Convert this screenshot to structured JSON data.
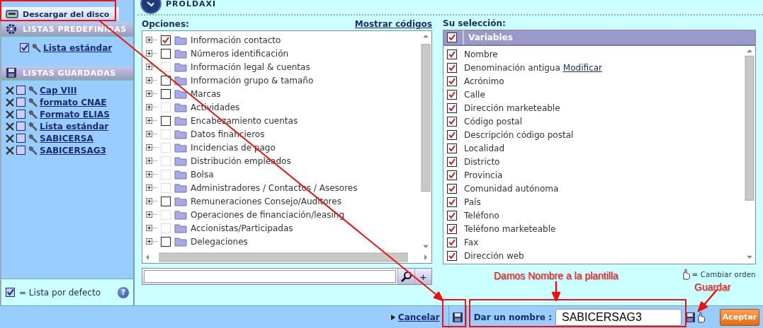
{
  "header": {
    "title": "PROLDAXI"
  },
  "sidebar": {
    "download_button": "Descargar del disco",
    "predefined": {
      "title": "LISTAS PREDEFINIDAS",
      "items": [
        {
          "label": "Lista estándar",
          "checked": true
        }
      ]
    },
    "saved": {
      "title": "LISTAS GUARDADAS",
      "items": [
        {
          "label": "Cap VIII",
          "checked": false
        },
        {
          "label": "formato CNAE",
          "checked": false
        },
        {
          "label": "Formato ELIAS",
          "checked": false
        },
        {
          "label": "Lista estándar",
          "checked": false
        },
        {
          "label": "SABICERSA",
          "checked": false
        },
        {
          "label": "SABICERSAG3",
          "checked": false
        }
      ]
    },
    "legend": "= Lista por defecto",
    "help": "?"
  },
  "options": {
    "title": "Opciones:",
    "link": "Mostrar códigos",
    "items": [
      {
        "label": "Información contacto",
        "checked": true,
        "disabled": false
      },
      {
        "label": "Números identificación",
        "checked": false,
        "disabled": false
      },
      {
        "label": "Información legal & cuentas",
        "checked": false,
        "disabled": true
      },
      {
        "label": "Información grupo & tamaño",
        "checked": false,
        "disabled": false
      },
      {
        "label": "Marcas",
        "checked": false,
        "disabled": false
      },
      {
        "label": "Actividades",
        "checked": false,
        "disabled": true
      },
      {
        "label": "Encabezamiento cuentas",
        "checked": false,
        "disabled": false
      },
      {
        "label": "Datos financieros",
        "checked": false,
        "disabled": true
      },
      {
        "label": "Incidencias de pago",
        "checked": false,
        "disabled": true
      },
      {
        "label": "Distribución empleados",
        "checked": false,
        "disabled": true
      },
      {
        "label": "Bolsa",
        "checked": false,
        "disabled": true
      },
      {
        "label": "Administradores / Contactos / Asesores",
        "checked": false,
        "disabled": true
      },
      {
        "label": "Remuneraciones Consejo/Auditores",
        "checked": false,
        "disabled": false
      },
      {
        "label": "Operaciones de financiación/leasing",
        "checked": false,
        "disabled": true
      },
      {
        "label": "Accionistas/Participadas",
        "checked": false,
        "disabled": true
      },
      {
        "label": "Delegaciones",
        "checked": false,
        "disabled": false
      }
    ],
    "add_button": "+"
  },
  "selection": {
    "title": "Su selección:",
    "header": "Variables",
    "header_checked": true,
    "items": [
      {
        "label": "Nombre",
        "checked": true
      },
      {
        "label": "Denominación antigua",
        "link": "Modificar",
        "checked": true
      },
      {
        "label": "Acrónimo",
        "checked": true
      },
      {
        "label": "Calle",
        "checked": true
      },
      {
        "label": "Dirección marketeable",
        "checked": true
      },
      {
        "label": "Código postal",
        "checked": true
      },
      {
        "label": "Descripción código postal",
        "checked": true
      },
      {
        "label": "Localidad",
        "checked": true
      },
      {
        "label": "Districto",
        "checked": true
      },
      {
        "label": "Provincia",
        "checked": true
      },
      {
        "label": "Comunidad autónoma",
        "checked": true
      },
      {
        "label": "País",
        "checked": true
      },
      {
        "label": "Teléfono",
        "checked": true
      },
      {
        "label": "Teléfono marketeable",
        "checked": true
      },
      {
        "label": "Fax",
        "checked": true
      },
      {
        "label": "Dirección web",
        "checked": true
      }
    ],
    "legend": "= Cambiar orden"
  },
  "footer": {
    "cancel": "Cancelar",
    "name_label": "Dar un nombre :",
    "name_value": "SABICERSAG3",
    "accept": "Aceptar"
  },
  "annotations": [
    {
      "text": "Damos Nombre a la plantilla"
    },
    {
      "text": "Guardar"
    }
  ]
}
